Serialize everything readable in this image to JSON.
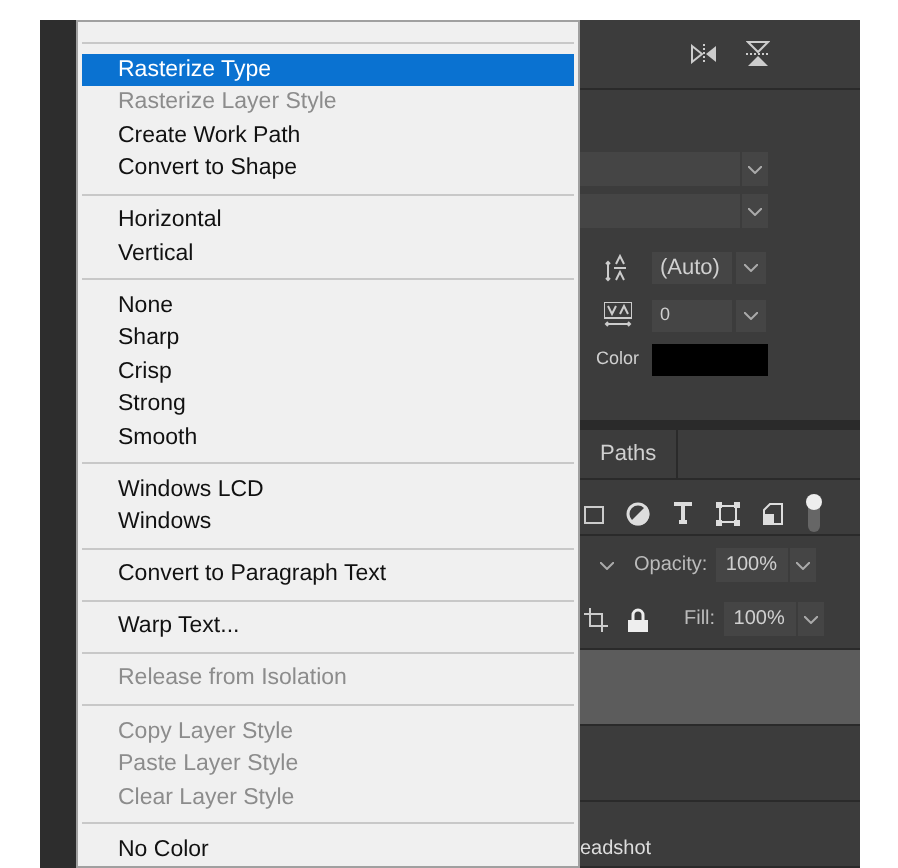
{
  "context_menu": {
    "items": [
      {
        "kind": "separator"
      },
      {
        "kind": "item",
        "label": "Rasterize Type",
        "selected": true,
        "disabled": false
      },
      {
        "kind": "item",
        "label": "Rasterize Layer Style",
        "selected": false,
        "disabled": true
      },
      {
        "kind": "item",
        "label": "Create Work Path",
        "selected": false,
        "disabled": false
      },
      {
        "kind": "item",
        "label": "Convert to Shape",
        "selected": false,
        "disabled": false
      },
      {
        "kind": "separator"
      },
      {
        "kind": "item",
        "label": "Horizontal",
        "selected": false,
        "disabled": false
      },
      {
        "kind": "item",
        "label": "Vertical",
        "selected": false,
        "disabled": false
      },
      {
        "kind": "separator"
      },
      {
        "kind": "item",
        "label": "None",
        "selected": false,
        "disabled": false
      },
      {
        "kind": "item",
        "label": "Sharp",
        "selected": false,
        "disabled": false
      },
      {
        "kind": "item",
        "label": "Crisp",
        "selected": false,
        "disabled": false
      },
      {
        "kind": "item",
        "label": "Strong",
        "selected": false,
        "disabled": false
      },
      {
        "kind": "item",
        "label": "Smooth",
        "selected": false,
        "disabled": false
      },
      {
        "kind": "separator"
      },
      {
        "kind": "item",
        "label": "Windows LCD",
        "selected": false,
        "disabled": false
      },
      {
        "kind": "item",
        "label": "Windows",
        "selected": false,
        "disabled": false
      },
      {
        "kind": "separator"
      },
      {
        "kind": "item",
        "label": "Convert to Paragraph Text",
        "selected": false,
        "disabled": false
      },
      {
        "kind": "separator"
      },
      {
        "kind": "item",
        "label": "Warp Text...",
        "selected": false,
        "disabled": false
      },
      {
        "kind": "separator"
      },
      {
        "kind": "item",
        "label": "Release from Isolation",
        "selected": false,
        "disabled": true
      },
      {
        "kind": "separator"
      },
      {
        "kind": "item",
        "label": "Copy Layer Style",
        "selected": false,
        "disabled": true
      },
      {
        "kind": "item",
        "label": "Paste Layer Style",
        "selected": false,
        "disabled": true
      },
      {
        "kind": "item",
        "label": "Clear Layer Style",
        "selected": false,
        "disabled": true
      },
      {
        "kind": "separator"
      },
      {
        "kind": "item",
        "label": "No Color",
        "selected": false,
        "disabled": false
      }
    ]
  },
  "character_panel": {
    "leading": "(Auto)",
    "tracking": "0",
    "color_label": "Color",
    "color": "#000000"
  },
  "layers_panel": {
    "tab": "Paths",
    "opacity_label": "Opacity:",
    "opacity": "100%",
    "fill_label": "Fill:",
    "fill": "100%",
    "layers": [
      {
        "selected": true
      },
      {
        "selected": false
      },
      {
        "name": "eadshot",
        "selected": false
      }
    ]
  }
}
